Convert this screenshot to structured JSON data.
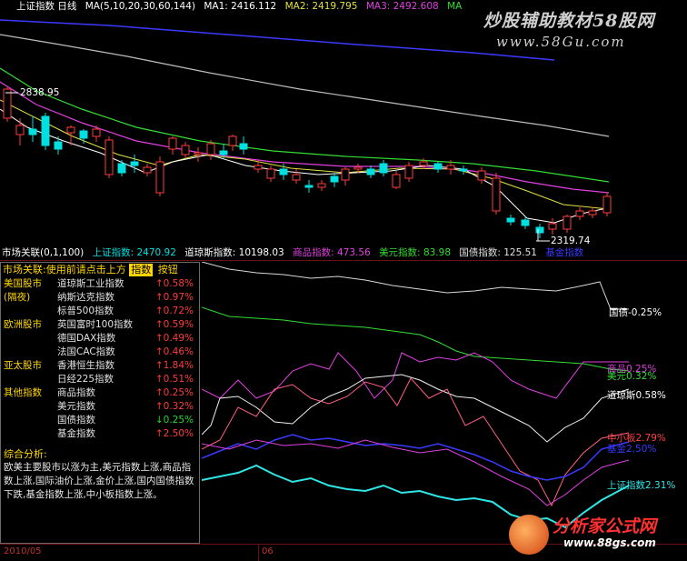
{
  "app": {
    "title": "上证指数 日线"
  },
  "top_legend": {
    "ma_params": "MA(5,10,20,30,60,144)",
    "ma1": "MA1: 2416.112",
    "ma2": "MA2: 2419.795",
    "ma3": "MA3: 2492.608",
    "ma4_prefix": "MA"
  },
  "watermark_top": {
    "line1": "炒股辅助教材58股网",
    "line2": "www.58Gu.com"
  },
  "price_labels": {
    "high": "2838.95",
    "low": "2319.74"
  },
  "mid_legend": {
    "title": "市场关联(0,1,100)",
    "shanghai": "上证指数: 2470.92",
    "dow": "道琼斯指数: 10198.03",
    "commodity": "商品指数: 473.56",
    "usd": "美元指数: 83.98",
    "bond": "国债指数: 125.51",
    "fund": "基金指数"
  },
  "panel": {
    "header": "市场关联:使用前请点击上方",
    "btn_index": "指数",
    "btn_button": "按钮",
    "rows": [
      {
        "cat": "美国股市",
        "name": "道琼斯工业指数",
        "val": "↑0.58%",
        "dir": "up"
      },
      {
        "cat": "(隔夜)",
        "name": "纳斯达克指数",
        "val": "↑0.97%",
        "dir": "up"
      },
      {
        "cat": "",
        "name": "标普500指数",
        "val": "↑0.72%",
        "dir": "up"
      },
      {
        "cat": "欧洲股市",
        "name": "英国富时100指数",
        "val": "↑0.59%",
        "dir": "up"
      },
      {
        "cat": "",
        "name": "德国DAX指数",
        "val": "↑0.49%",
        "dir": "up"
      },
      {
        "cat": "",
        "name": "法国CAC指数",
        "val": "↑0.46%",
        "dir": "up"
      },
      {
        "cat": "亚太股市",
        "name": "香港恒生指数",
        "val": "↑1.84%",
        "dir": "up"
      },
      {
        "cat": "",
        "name": "日经225指数",
        "val": "↑0.51%",
        "dir": "up"
      },
      {
        "cat": "其他指数",
        "name": "商品指数",
        "val": "↑0.25%",
        "dir": "up"
      },
      {
        "cat": "",
        "name": "美元指数",
        "val": "↑0.32%",
        "dir": "up"
      },
      {
        "cat": "",
        "name": "国债指数",
        "val": "↓0.25%",
        "dir": "down"
      },
      {
        "cat": "",
        "name": "基金指数",
        "val": "↑2.50%",
        "dir": "up"
      }
    ],
    "summary_title": "综合分析:",
    "summary_text": "欧美主要股市以涨为主,美元指数上涨,商品指数上涨,国际油价上涨,金价上涨,国内国债指数下跌,基金指数上涨,中小板指数上涨。"
  },
  "series_labels": {
    "bond": "国债-0.25%",
    "commodity": "商品0.25%",
    "usd": "美元0.32%",
    "dow": "道琼斯0.58%",
    "sme": "中小板2.79%",
    "fund": "基金2.50%",
    "shanghai": "上证指数2.31%"
  },
  "axis": {
    "date_left": "2010/05",
    "date_mid": "06"
  },
  "watermark_bottom": {
    "line1": "分析家公式网",
    "line2": "www.88gs.com"
  },
  "colors": {
    "up": "#ff3c3c",
    "down": "#00e0e0",
    "ma5": "#ffffff",
    "ma10": "#ffff40",
    "ma20": "#ff40ff",
    "ma30": "#40ff40",
    "ma60": "#c0c0c0",
    "ma144": "#4040ff"
  }
}
